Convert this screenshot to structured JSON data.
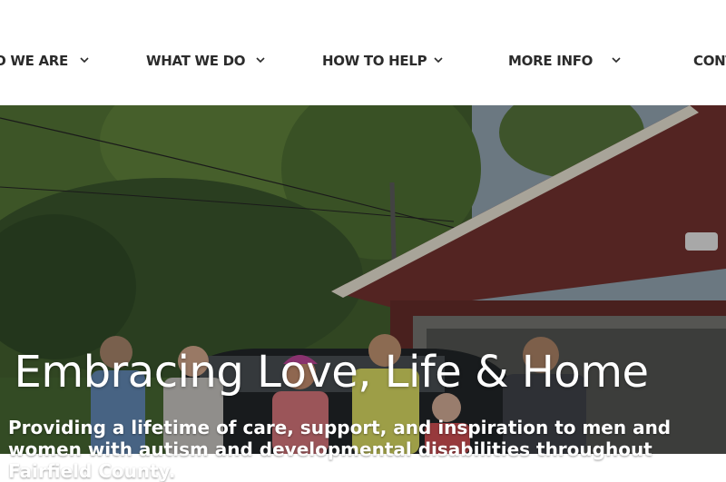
{
  "nav": {
    "items": [
      {
        "label": "O WE ARE"
      },
      {
        "label": "WHAT WE DO"
      },
      {
        "label": "HOW TO HELP"
      },
      {
        "label": "MORE INFO"
      },
      {
        "label": "CONT"
      }
    ]
  },
  "hero": {
    "title": "Embracing Love, Life & Home",
    "subtitle": "Providing a lifetime of care, support, and inspiration to men and women with autism and developmental disabilities throughout Fairfield County."
  },
  "colors": {
    "nav_text": "#2b2b2b",
    "hero_text": "#ffffff",
    "house_siding": "#6b2f2c"
  },
  "icons": {
    "chevron": "chevron-down-icon"
  }
}
